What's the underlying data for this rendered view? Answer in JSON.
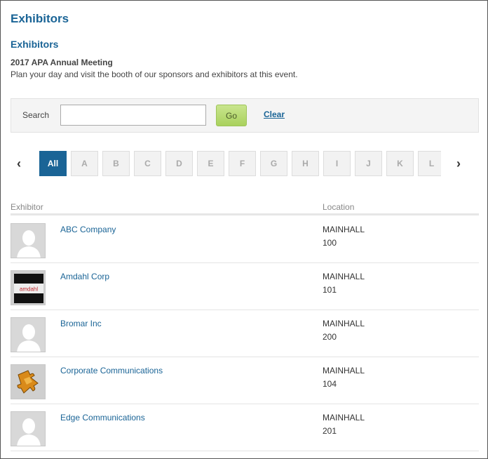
{
  "header": {
    "page_title": "Exhibitors",
    "section_title": "Exhibitors",
    "event_name": "2017 APA Annual Meeting",
    "event_description": "Plan your day and visit the booth of our sponsors and exhibitors at this event."
  },
  "search": {
    "label": "Search",
    "value": "",
    "placeholder": "",
    "go_label": "Go",
    "clear_label": "Clear"
  },
  "alpha_nav": {
    "prev_icon": "chevron-left-icon",
    "next_icon": "chevron-right-icon",
    "letters": [
      "All",
      "A",
      "B",
      "C",
      "D",
      "E",
      "F",
      "G",
      "H",
      "I",
      "J",
      "K",
      "L"
    ],
    "active": "All"
  },
  "table": {
    "col_exhibitor": "Exhibitor",
    "col_location": "Location",
    "rows": [
      {
        "name": "ABC Company",
        "hall": "MAINHALL",
        "booth": "100",
        "logo": "placeholder-person"
      },
      {
        "name": "Amdahl Corp",
        "hall": "MAINHALL",
        "booth": "101",
        "logo": "amdahl-logo",
        "logo_text": "amdahl"
      },
      {
        "name": "Bromar Inc",
        "hall": "MAINHALL",
        "booth": "200",
        "logo": "placeholder-person"
      },
      {
        "name": "Corporate Communications",
        "hall": "MAINHALL",
        "booth": "104",
        "logo": "puzzle-logo"
      },
      {
        "name": "Edge Communications",
        "hall": "MAINHALL",
        "booth": "201",
        "logo": "placeholder-person"
      }
    ]
  },
  "colors": {
    "accent": "#1a6496",
    "go_button": "#a9d15d"
  }
}
